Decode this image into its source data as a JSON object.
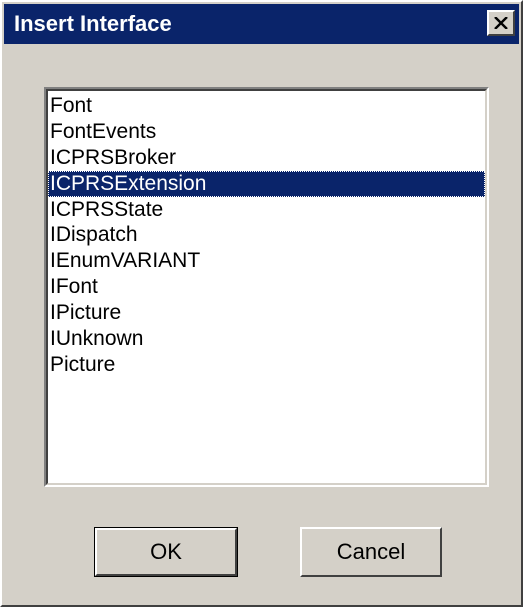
{
  "window": {
    "title": "Insert Interface"
  },
  "list": {
    "items": [
      "Font",
      "FontEvents",
      "ICPRSBroker",
      "ICPRSExtension",
      "ICPRSState",
      "IDispatch",
      "IEnumVARIANT",
      "IFont",
      "IPicture",
      "IUnknown",
      "Picture"
    ],
    "selected": "ICPRSExtension"
  },
  "buttons": {
    "ok": "OK",
    "cancel": "Cancel"
  },
  "colors": {
    "selection": "#0a246a",
    "face": "#d4d0c8"
  }
}
